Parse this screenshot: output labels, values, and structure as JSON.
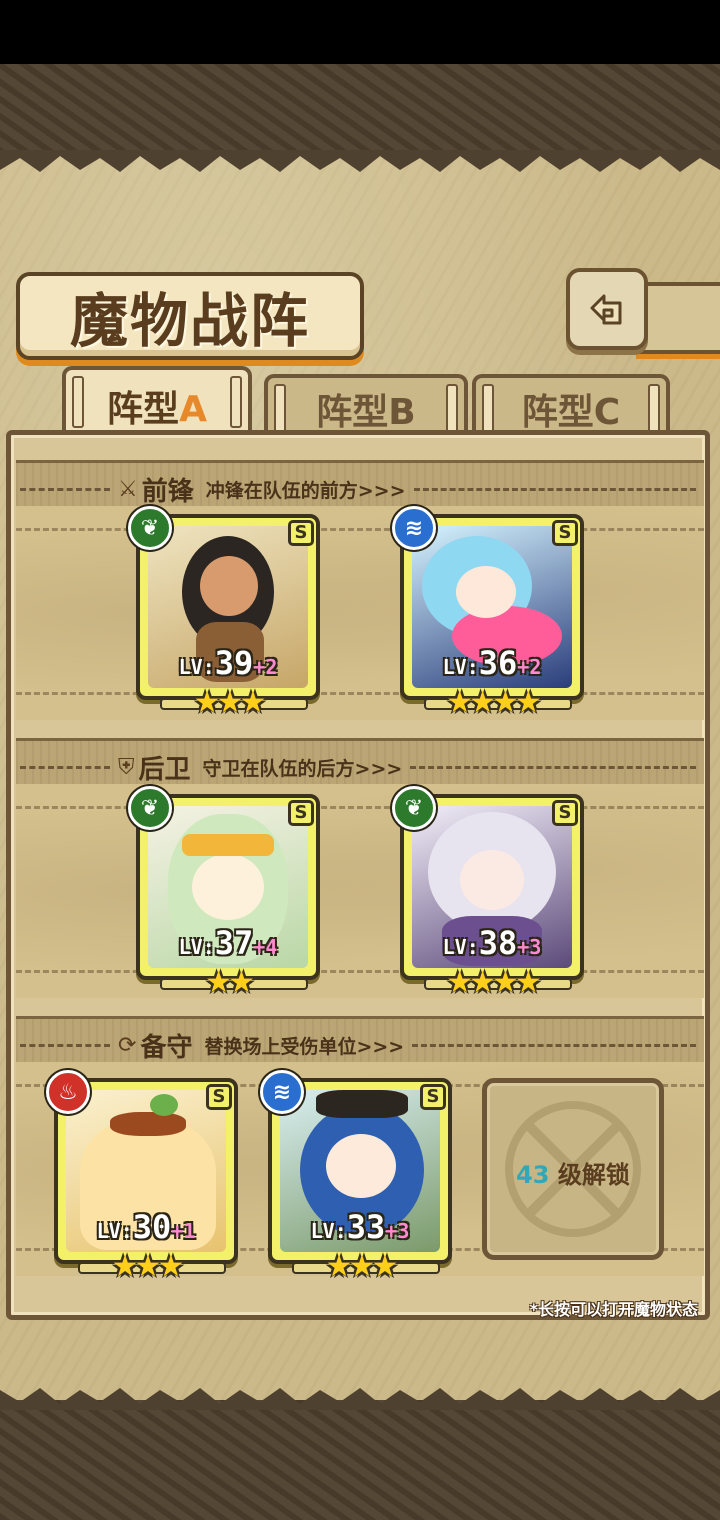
{
  "screen": {
    "title": "魔物战阵"
  },
  "tabs": [
    {
      "prefix": "阵型",
      "letter": "A",
      "active": true
    },
    {
      "prefix": "阵型",
      "letter": "B",
      "active": false
    },
    {
      "prefix": "阵型",
      "letter": "C",
      "active": false
    }
  ],
  "sections": {
    "front": {
      "icon": "sword-icon",
      "name": "前锋",
      "desc": "冲锋在队伍的前方>>>"
    },
    "rear": {
      "icon": "shield-icon",
      "name": "后卫",
      "desc": "守卫在队伍的后方>>>"
    },
    "reserve": {
      "icon": "swap-icon",
      "name": "备守",
      "desc": "替换场上受伤单位>>>"
    }
  },
  "monsters": [
    {
      "slot": "front-1",
      "element": "leaf",
      "rank": "S",
      "lv_prefix": "LV:",
      "level": "39",
      "bonus": "+2",
      "stars": "★★★"
    },
    {
      "slot": "front-2",
      "element": "water",
      "rank": "S",
      "lv_prefix": "LV:",
      "level": "36",
      "bonus": "+2",
      "stars": "★★★★"
    },
    {
      "slot": "rear-1",
      "element": "leaf",
      "rank": "S",
      "lv_prefix": "LV:",
      "level": "37",
      "bonus": "+4",
      "stars": "★★"
    },
    {
      "slot": "rear-2",
      "element": "leaf",
      "rank": "S",
      "lv_prefix": "LV:",
      "level": "38",
      "bonus": "+3",
      "stars": "★★★★"
    },
    {
      "slot": "reserve-1",
      "element": "fire",
      "rank": "S",
      "lv_prefix": "LV:",
      "level": "30",
      "bonus": "+1",
      "stars": "★★★"
    },
    {
      "slot": "reserve-2",
      "element": "water",
      "rank": "S",
      "lv_prefix": "LV:",
      "level": "33",
      "bonus": "+3",
      "stars": "★★★"
    }
  ],
  "locked_slot": {
    "level": "43",
    "text": "级解锁"
  },
  "hint": "*长按可以打开魔物状态",
  "element_glyphs": {
    "leaf": "❦",
    "water": "≋",
    "fire": "♨"
  },
  "colors": {
    "card_frame": "#f3f06a",
    "accent_orange": "#e7892b",
    "lock_level": "#2fa8b8"
  }
}
